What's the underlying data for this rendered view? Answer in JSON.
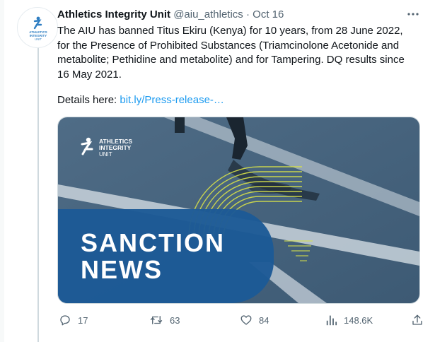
{
  "tweet": {
    "author_name": "Athletics Integrity Unit",
    "handle": "@aiu_athletics",
    "separator": "·",
    "date": "Oct 16",
    "text": "The AIU has banned Titus Ekiru (Kenya) for 10 years, from 28 June 2022, for the Presence of Prohibited Substances (Triamcinolone Acetonide and metabolite; Pethidine and metabolite) and for Tampering. DQ results since 16 May 2021.",
    "details_label": "Details here: ",
    "details_link": "bit.ly/Press-release-…",
    "more_icon": "more-icon"
  },
  "avatar_logo": {
    "line1": "ATHLETICS",
    "line2": "INTEGRITY",
    "line3": "UNIT"
  },
  "media": {
    "logo_line1": "ATHLETICS",
    "logo_line2": "INTEGRITY",
    "logo_line3": "UNIT",
    "headline_line1": "SANCTION",
    "headline_line2": "NEWS"
  },
  "actions": {
    "replies": "17",
    "retweets": "63",
    "likes": "84",
    "views": "148.6K"
  },
  "colors": {
    "link": "#1d9bf0",
    "muted": "#536471",
    "media_bg": "#45637d",
    "panel_blue": "#1c5a96",
    "accent_yellow": "#d6e04a"
  }
}
